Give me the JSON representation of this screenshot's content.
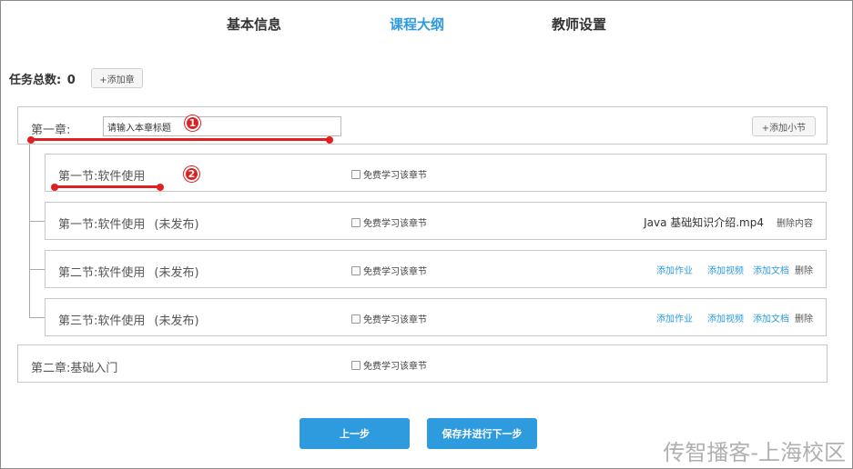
{
  "tabs": [
    {
      "label": "基本信息"
    },
    {
      "label": "课程大纲"
    },
    {
      "label": "教师设置"
    }
  ],
  "colors": {
    "accent": "#2e9bde",
    "annotation": "#e02020"
  },
  "summary": {
    "label": "任务总数:",
    "count": "0",
    "add_chapter": "+添加章"
  },
  "chapter1": {
    "label": "第一章:",
    "title_value": "请输入本章标题",
    "add_section": "+添加小节"
  },
  "sections": [
    {
      "label": "第一节:软件使用",
      "status": "",
      "free": "免费学习该章节"
    },
    {
      "label": "第一节:软件使用",
      "status": "(未发布)",
      "free": "免费学习该章节",
      "file": "Java 基础知识介绍.mp4",
      "delete_content": "删除内容"
    },
    {
      "label": "第二节:软件使用",
      "status": "(未发布)",
      "free": "免费学习该章节",
      "add_homework": "添加作业",
      "add_video": "添加视频",
      "add_doc": "添加文档",
      "delete": "删除"
    },
    {
      "label": "第三节:软件使用",
      "status": "(未发布)",
      "free": "免费学习该章节",
      "add_homework": "添加作业",
      "add_video": "添加视频",
      "add_doc": "添加文档",
      "delete": "删除"
    }
  ],
  "chapter2": {
    "label": "第二章:基础入门",
    "free": "免费学习该章节"
  },
  "buttons": {
    "prev": "上一步",
    "save_next": "保存并进行下一步"
  },
  "annotations": {
    "m1": "1",
    "m2": "2"
  },
  "watermark": "传智播客-上海校区"
}
